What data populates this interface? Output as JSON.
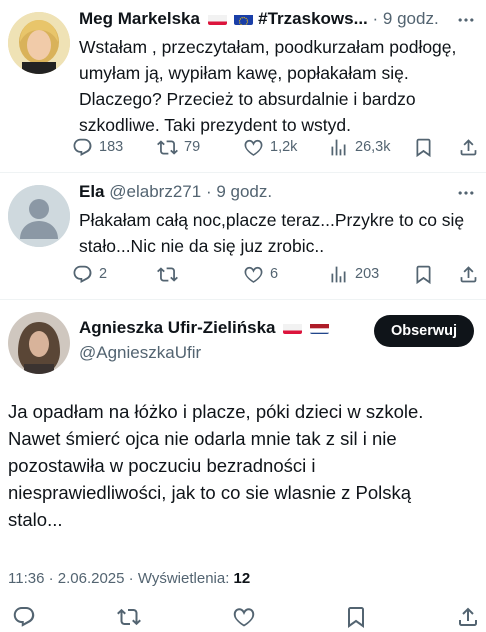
{
  "reply1": {
    "name": "Meg Markelska",
    "flags": [
      "pl-flag",
      "eu-flag"
    ],
    "hashtag": "#Trzaskows...",
    "time": "· 9 godz.",
    "text_lines": [
      "Wstałam , przeczytałam, poodkurzałam podłogę,",
      "umyłam ją, wypiłam kawę, popłakałam się.",
      "Dlaczego? Przecież to absurdalnie i bardzo",
      "szkodliwe. Taki prezydent to wstyd."
    ],
    "replies": "183",
    "reposts": "79",
    "likes": "1,2k",
    "views": "26,3k"
  },
  "reply2": {
    "name": "Ela",
    "handle": "@elabrz271",
    "time": "· 9 godz.",
    "text_lines": [
      "Płakałam całą noc,placze teraz...Przykre to co się",
      "stało...Nic nie da się juz zrobic.."
    ],
    "replies": "2",
    "reposts": "",
    "likes": "6",
    "views": "203"
  },
  "main_tweet": {
    "name": "Agnieszka Ufir-Zielińska",
    "flags": [
      "pl-flag",
      "nl-flag"
    ],
    "handle": "@AgnieszkaUfir",
    "follow_label": "Obserwuj",
    "text_lines": [
      "Ja opadłam na łóżko i placze, póki dzieci w szkole.",
      "Nawet śmierć ojca nie odarla mnie tak z sil i nie",
      "pozostawiła w poczuciu bezradności i",
      "niesprawiedliwości, jak to co sie wlasnie z Polską",
      "stalo..."
    ],
    "timestamp": "11:36 · 2.06.2025 · Wyświetlenia:",
    "views": "12"
  },
  "colors": {
    "text": "#0f1419",
    "muted": "#536471",
    "button_bg": "#0f1419",
    "divider": "#eff3f4"
  },
  "icons": [
    "reply-icon",
    "repost-icon",
    "like-icon",
    "views-icon",
    "bookmark-icon",
    "share-icon",
    "more-icon"
  ]
}
